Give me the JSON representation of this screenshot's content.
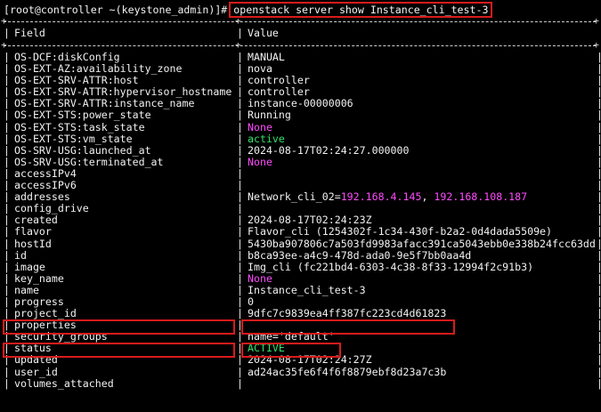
{
  "prompt": "[root@controller ~(keystone_admin)]#",
  "command": "openstack server show Instance_cli_test-3",
  "header": {
    "field": "Field",
    "value": "Value"
  },
  "rows": [
    {
      "field": "OS-DCF:diskConfig",
      "value": "MANUAL"
    },
    {
      "field": "OS-EXT-AZ:availability_zone",
      "value": "nova"
    },
    {
      "field": "OS-EXT-SRV-ATTR:host",
      "value": "controller"
    },
    {
      "field": "OS-EXT-SRV-ATTR:hypervisor_hostname",
      "value": "controller"
    },
    {
      "field": "OS-EXT-SRV-ATTR:instance_name",
      "value": "instance-00000006"
    },
    {
      "field": "OS-EXT-STS:power_state",
      "value": "Running"
    },
    {
      "field": "OS-EXT-STS:task_state",
      "value": "None"
    },
    {
      "field": "OS-EXT-STS:vm_state",
      "value": "active"
    },
    {
      "field": "OS-SRV-USG:launched_at",
      "value": "2024-08-17T02:24:27.000000"
    },
    {
      "field": "OS-SRV-USG:terminated_at",
      "value": "None"
    },
    {
      "field": "accessIPv4",
      "value": ""
    },
    {
      "field": "accessIPv6",
      "value": ""
    },
    {
      "field": "addresses",
      "value_prefix": "Network_cli_02=",
      "ip1": "192.168.4.145",
      "sep": ", ",
      "ip2": "192.168.108.187"
    },
    {
      "field": "config_drive",
      "value": ""
    },
    {
      "field": "created",
      "value": "2024-08-17T02:24:23Z"
    },
    {
      "field": "flavor",
      "value": "Flavor_cli (1254302f-1c34-430f-b2a2-0d4dada5509e)"
    },
    {
      "field": "hostId",
      "value": "5430ba907806c7a503fd9983afacc391ca5043ebb0e338b24fcc63dd"
    },
    {
      "field": "id",
      "value": "b8ca93ee-a4c9-478d-ada0-9e5f7bb0aa4d"
    },
    {
      "field": "image",
      "value": "Img_cli (fc221bd4-6303-4c38-8f33-12994f2c91b3)"
    },
    {
      "field": "key_name",
      "value": "None"
    },
    {
      "field": "name",
      "value": "Instance_cli_test-3"
    },
    {
      "field": "progress",
      "value": "0"
    },
    {
      "field": "project_id",
      "value": "9dfc7c9839ea4ff387fc223cd4d61823"
    },
    {
      "field": "properties",
      "value": ""
    },
    {
      "field": "security_groups",
      "value": "name='default'"
    },
    {
      "field": "status",
      "value": "ACTIVE"
    },
    {
      "field": "updated",
      "value": "2024-08-17T02:24:27Z"
    },
    {
      "field": "user_id",
      "value": "ad24ac35fe6f4f6f8879ebf8d23a7c3b"
    },
    {
      "field": "volumes_attached",
      "value": ""
    }
  ],
  "colors": {
    "highlight": "#d81b1b",
    "green": "#31e06a",
    "magenta": "#ff4cff"
  }
}
